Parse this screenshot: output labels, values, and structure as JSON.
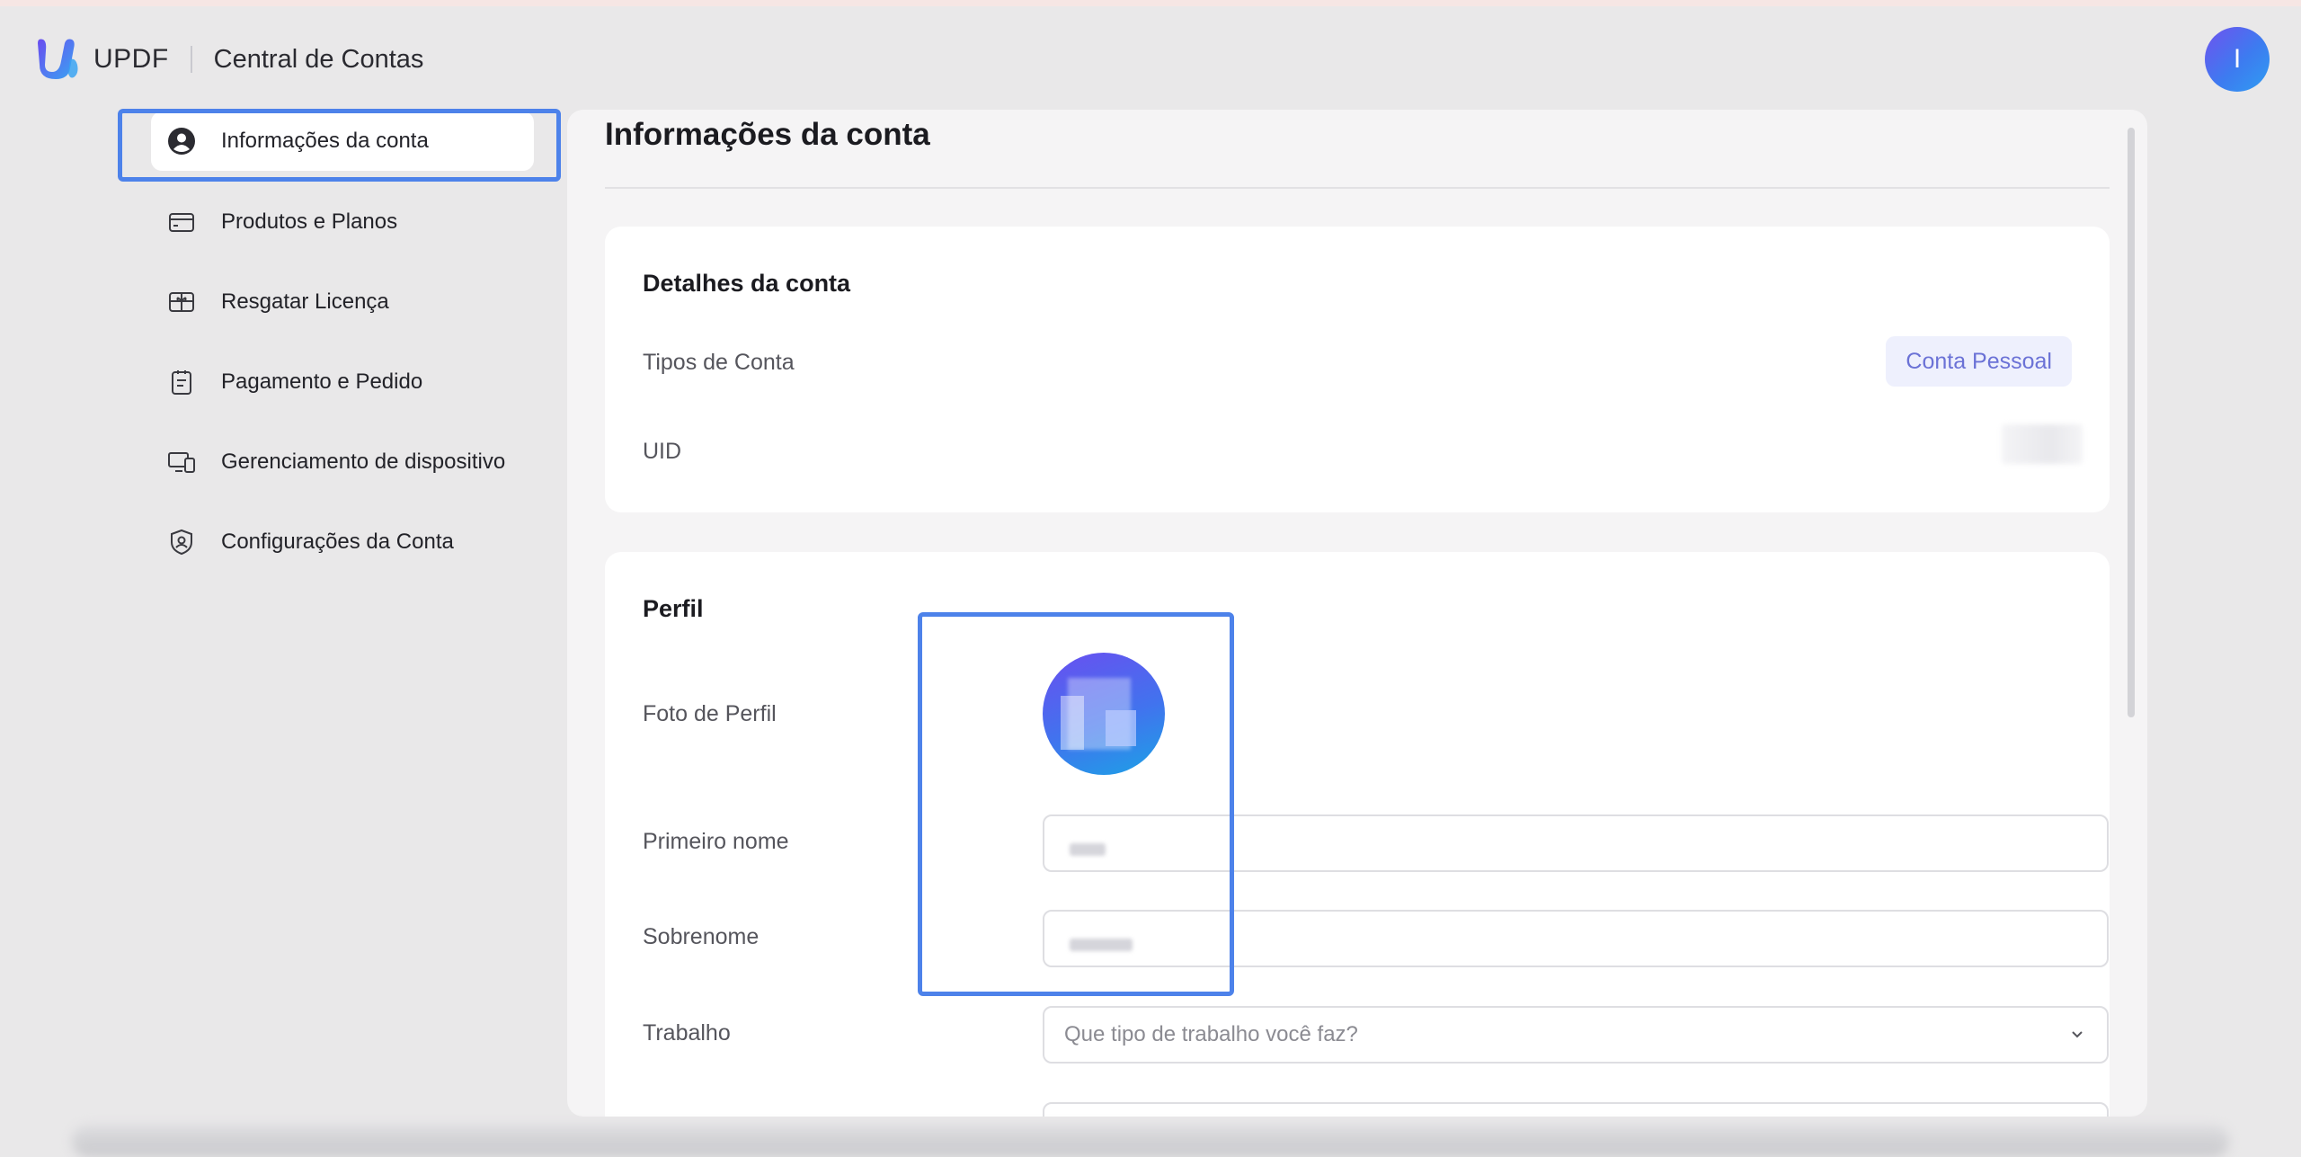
{
  "header": {
    "brand_name": "UPDF",
    "title": "Central de Contas",
    "avatar_initial": "I",
    "logo_icon": "updf-logo-icon"
  },
  "sidebar": {
    "items": [
      {
        "label": "Informações da conta",
        "icon": "user-circle-icon",
        "active": true
      },
      {
        "label": "Produtos e Planos",
        "icon": "credit-card-icon",
        "active": false
      },
      {
        "label": "Resgatar Licença",
        "icon": "gift-icon",
        "active": false
      },
      {
        "label": "Pagamento e Pedido",
        "icon": "clipboard-icon",
        "active": false
      },
      {
        "label": "Gerenciamento de dispositivo",
        "icon": "devices-icon",
        "active": false
      },
      {
        "label": "Configurações da Conta",
        "icon": "shield-user-icon",
        "active": false
      }
    ]
  },
  "main": {
    "title": "Informações da conta",
    "account_details": {
      "title": "Detalhes da conta",
      "account_type_label": "Tipos de Conta",
      "account_type_value": "Conta Pessoal",
      "uid_label": "UID"
    },
    "profile": {
      "title": "Perfil",
      "photo_label": "Foto de Perfil",
      "first_name_label": "Primeiro nome",
      "last_name_label": "Sobrenome",
      "work_label": "Trabalho",
      "work_placeholder": "Que tipo de trabalho você faz?"
    }
  },
  "colors": {
    "accent": "#4d82ea",
    "badge_text": "#6b72d6",
    "background": "#e9e8e9"
  }
}
